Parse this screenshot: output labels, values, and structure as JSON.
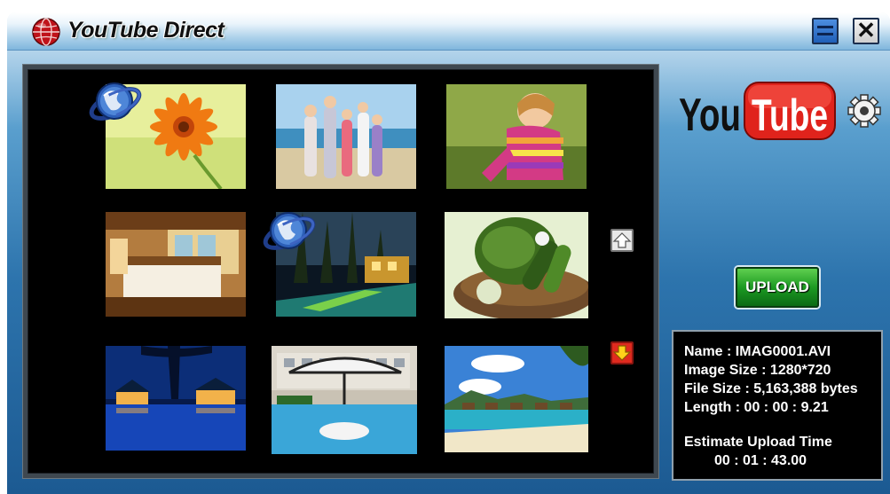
{
  "window": {
    "title": "YouTube Direct",
    "icons": {
      "app": "globe-icon",
      "minimize": "minimize-icon",
      "close": "close-icon"
    },
    "close_glyph": "✕"
  },
  "brand": {
    "logo_you": "You",
    "logo_tube": "Tube",
    "settings_icon": "gear-icon",
    "colors": {
      "tube_red": "#e0231c",
      "accent_blue": "#2d74ad",
      "upload_green": "#1c9a22"
    }
  },
  "gallery": {
    "items": [
      {
        "subject": "orange gerbera flower",
        "uploaded": true
      },
      {
        "subject": "family on beach",
        "uploaded": false
      },
      {
        "subject": "girl in striped sweater",
        "uploaded": false
      },
      {
        "subject": "hotel bedroom",
        "uploaded": false
      },
      {
        "subject": "resort pool at night",
        "uploaded": true
      },
      {
        "subject": "basket of vegetables",
        "uploaded": false
      },
      {
        "subject": "water villas at dusk",
        "uploaded": false
      },
      {
        "subject": "pool with umbrella",
        "uploaded": false
      },
      {
        "subject": "tropical beach with huts",
        "uploaded": false
      }
    ],
    "scroll_up_icon": "arrow-up-icon",
    "scroll_down_icon": "arrow-down-icon"
  },
  "actions": {
    "upload_label": "UPLOAD"
  },
  "info": {
    "name": "Name : IMAG0001.AVI",
    "image_size": "Image Size : 1280*720",
    "file_size": "File Size : 5,163,388 bytes",
    "length": "Length : 00 : 00 : 9.21",
    "estimate_label": "Estimate Upload Time",
    "estimate_value": "00 : 01 : 43.00"
  }
}
